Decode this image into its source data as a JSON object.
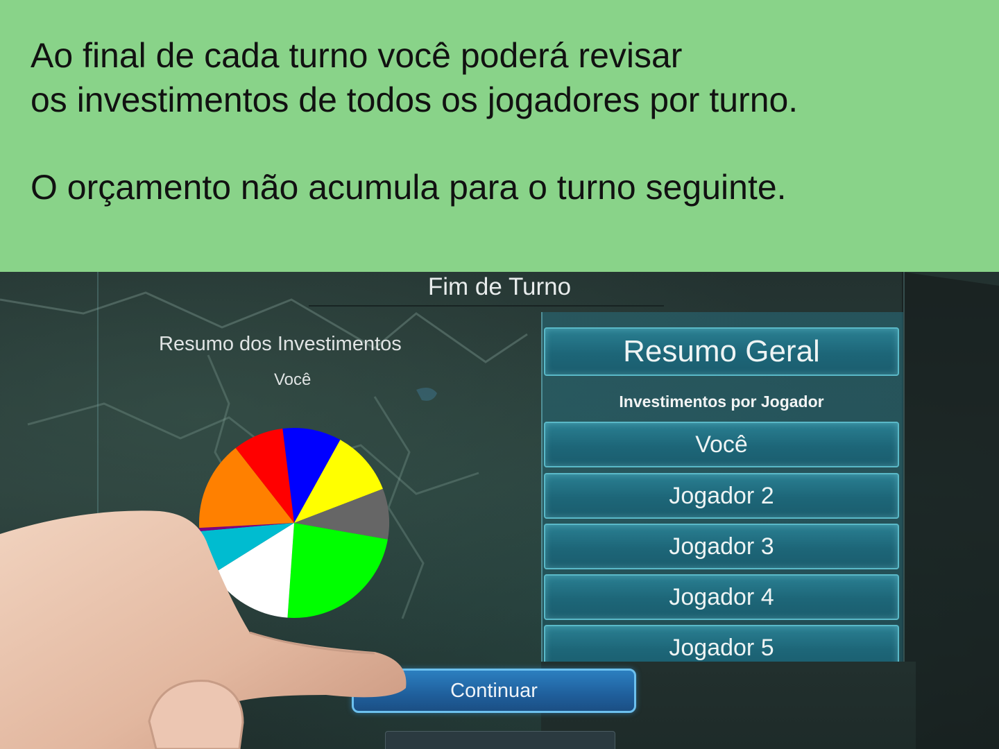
{
  "banner": {
    "line1": "Ao final de cada turno você poderá revisar",
    "line2": "os investimentos de todos os jogadores por turno.",
    "line3": "O orçamento não acumula para o turno seguinte.",
    "background_color": "#89d389"
  },
  "modal": {
    "title": "Fim de Turno",
    "summary_title": "Resumo dos Investimentos",
    "summary_player": "Você",
    "pie_colors": [
      "#0000ff",
      "#ffff00",
      "#666666",
      "#00ff00",
      "#ffffff",
      "#00bcd0",
      "#800080",
      "#ff8000",
      "#ff0000"
    ]
  },
  "right_panel": {
    "header_button": "Resumo Geral",
    "players_label": "Investimentos por Jogador",
    "player_buttons": [
      "Você",
      "Jogador 2",
      "Jogador 3",
      "Jogador 4",
      "Jogador 5"
    ]
  },
  "footer": {
    "continue_label": "Continuar"
  }
}
